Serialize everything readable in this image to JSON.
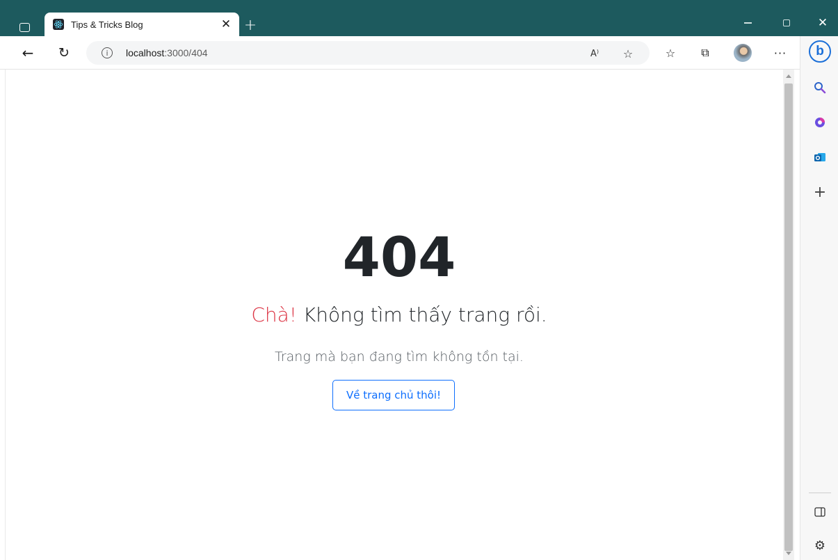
{
  "browser": {
    "tab": {
      "title": "Tips & Tricks Blog",
      "favicon": "react-icon",
      "close_glyph": "✕"
    },
    "new_tab_glyph": "+",
    "window_controls": {
      "close_glyph": "✕"
    },
    "toolbar": {
      "back_glyph": "←",
      "reload_glyph": "↻",
      "info_glyph": "i",
      "url_host": "localhost",
      "url_path": ":3000/404",
      "read_aloud_glyph": "A⁾",
      "add_favorite_glyph": "☆",
      "favorites_glyph": "☆",
      "collections_glyph": "⧉",
      "more_glyph": "···"
    },
    "sidebar": {
      "bing_glyph": "b",
      "add_glyph": "+",
      "settings_glyph": "⚙"
    }
  },
  "page": {
    "error_code": "404",
    "title_accent": "Chà!",
    "title_rest": " Không tìm thấy trang rồi.",
    "description": "Trang mà bạn đang tìm không tồn tại.",
    "home_button": "Về trang chủ thôi!"
  },
  "colors": {
    "titlebar": "#1d5a5e",
    "accent_red": "#dc3545",
    "button_blue": "#0d6efd",
    "text_dark": "#212529"
  }
}
